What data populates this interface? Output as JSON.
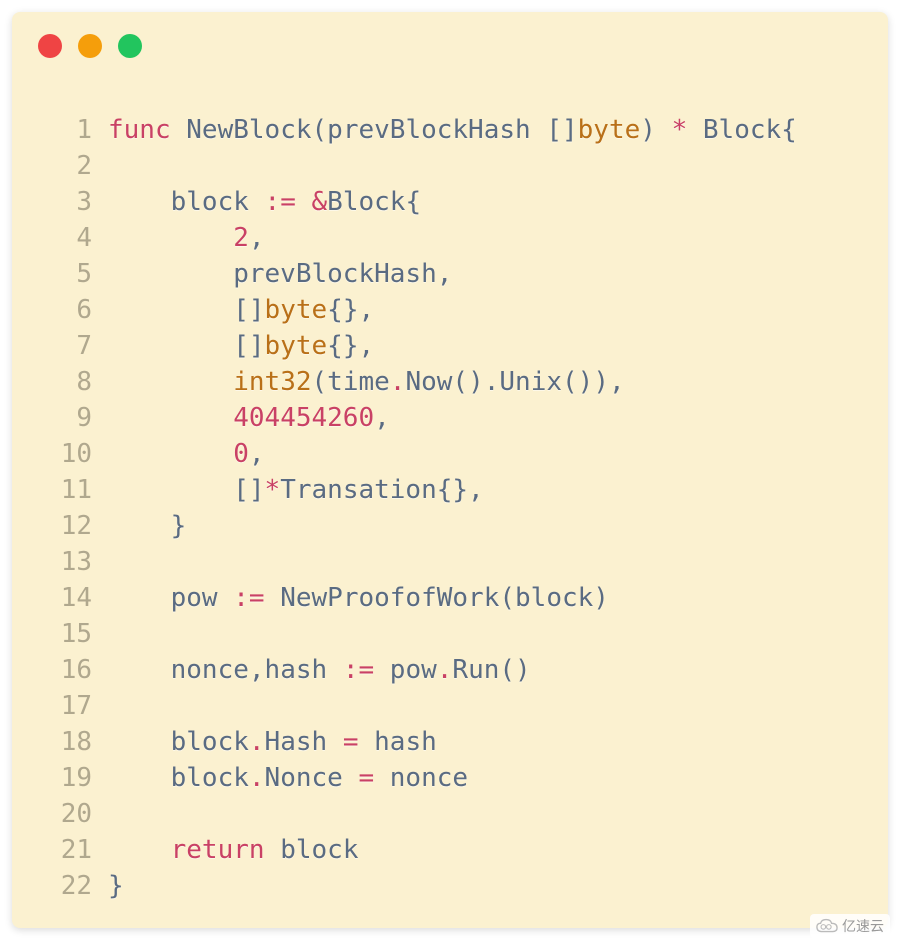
{
  "colors": {
    "kw": "#c94165",
    "ident": "#5a6b82",
    "type": "#b97018",
    "op": "#c94165",
    "punct": "#5a6b82",
    "num": "#c94165",
    "default": "#333333"
  },
  "code": [
    [
      {
        "t": "func ",
        "c": "kw"
      },
      {
        "t": "NewBlock",
        "c": "ident"
      },
      {
        "t": "(",
        "c": "punct"
      },
      {
        "t": "prevBlockHash ",
        "c": "ident"
      },
      {
        "t": "[]",
        "c": "punct"
      },
      {
        "t": "byte",
        "c": "type"
      },
      {
        "t": ") ",
        "c": "punct"
      },
      {
        "t": "* ",
        "c": "op"
      },
      {
        "t": "Block",
        "c": "ident"
      },
      {
        "t": "{",
        "c": "punct"
      }
    ],
    [],
    [
      {
        "t": "    block ",
        "c": "ident"
      },
      {
        "t": ":= &",
        "c": "op"
      },
      {
        "t": "Block",
        "c": "ident"
      },
      {
        "t": "{",
        "c": "punct"
      }
    ],
    [
      {
        "t": "        ",
        "c": "default"
      },
      {
        "t": "2",
        "c": "num"
      },
      {
        "t": ",",
        "c": "punct"
      }
    ],
    [
      {
        "t": "        prevBlockHash",
        "c": "ident"
      },
      {
        "t": ",",
        "c": "punct"
      }
    ],
    [
      {
        "t": "        []",
        "c": "punct"
      },
      {
        "t": "byte",
        "c": "type"
      },
      {
        "t": "{},",
        "c": "punct"
      }
    ],
    [
      {
        "t": "        []",
        "c": "punct"
      },
      {
        "t": "byte",
        "c": "type"
      },
      {
        "t": "{},",
        "c": "punct"
      }
    ],
    [
      {
        "t": "        ",
        "c": "default"
      },
      {
        "t": "int32",
        "c": "type"
      },
      {
        "t": "(",
        "c": "punct"
      },
      {
        "t": "time",
        "c": "ident"
      },
      {
        "t": ".",
        "c": "op"
      },
      {
        "t": "Now",
        "c": "ident"
      },
      {
        "t": "().",
        "c": "punct"
      },
      {
        "t": "Unix",
        "c": "ident"
      },
      {
        "t": "()),",
        "c": "punct"
      }
    ],
    [
      {
        "t": "        ",
        "c": "default"
      },
      {
        "t": "404454260",
        "c": "num"
      },
      {
        "t": ",",
        "c": "punct"
      }
    ],
    [
      {
        "t": "        ",
        "c": "default"
      },
      {
        "t": "0",
        "c": "num"
      },
      {
        "t": ",",
        "c": "punct"
      }
    ],
    [
      {
        "t": "        []",
        "c": "punct"
      },
      {
        "t": "*",
        "c": "op"
      },
      {
        "t": "Transation",
        "c": "ident"
      },
      {
        "t": "{},",
        "c": "punct"
      }
    ],
    [
      {
        "t": "    }",
        "c": "punct"
      }
    ],
    [],
    [
      {
        "t": "    pow ",
        "c": "ident"
      },
      {
        "t": ":= ",
        "c": "op"
      },
      {
        "t": "NewProofofWork",
        "c": "ident"
      },
      {
        "t": "(",
        "c": "punct"
      },
      {
        "t": "block",
        "c": "ident"
      },
      {
        "t": ")",
        "c": "punct"
      }
    ],
    [],
    [
      {
        "t": "    nonce",
        "c": "ident"
      },
      {
        "t": ",",
        "c": "punct"
      },
      {
        "t": "hash ",
        "c": "ident"
      },
      {
        "t": ":= ",
        "c": "op"
      },
      {
        "t": "pow",
        "c": "ident"
      },
      {
        "t": ".",
        "c": "op"
      },
      {
        "t": "Run",
        "c": "ident"
      },
      {
        "t": "()",
        "c": "punct"
      }
    ],
    [],
    [
      {
        "t": "    block",
        "c": "ident"
      },
      {
        "t": ".",
        "c": "op"
      },
      {
        "t": "Hash ",
        "c": "ident"
      },
      {
        "t": "= ",
        "c": "op"
      },
      {
        "t": "hash",
        "c": "ident"
      }
    ],
    [
      {
        "t": "    block",
        "c": "ident"
      },
      {
        "t": ".",
        "c": "op"
      },
      {
        "t": "Nonce ",
        "c": "ident"
      },
      {
        "t": "= ",
        "c": "op"
      },
      {
        "t": "nonce",
        "c": "ident"
      }
    ],
    [],
    [
      {
        "t": "    ",
        "c": "default"
      },
      {
        "t": "return ",
        "c": "kw"
      },
      {
        "t": "block",
        "c": "ident"
      }
    ],
    [
      {
        "t": "}",
        "c": "punct"
      }
    ]
  ],
  "watermark": {
    "text": "亿速云"
  }
}
